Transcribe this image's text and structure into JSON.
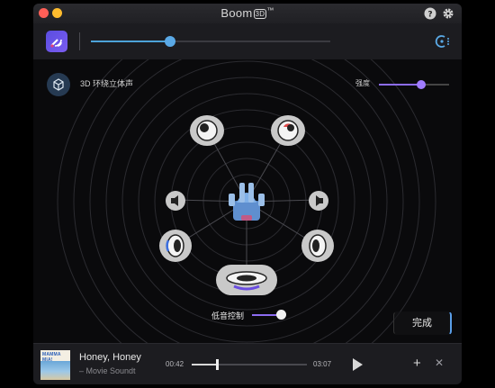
{
  "window": {
    "title": "Boom",
    "title_badge": "3D",
    "title_mark": "™"
  },
  "toolbar": {
    "volume_level": 0.33
  },
  "surround": {
    "label": "3D 环绕立体声",
    "strength_label": "强度",
    "strength_level": 0.6,
    "bass_label": "低音控制",
    "bass_level": 0.9,
    "done_label": "完成"
  },
  "player": {
    "song_title": "Honey, Honey",
    "album_sub": "– Movie Soundtrack",
    "album_art_text": "MAMMA MIA!",
    "time_current": "00:42",
    "time_total": "03:07",
    "progress": 0.22
  },
  "colors": {
    "accent_blue": "#4da3d9",
    "accent_purple": "#8c6cf0"
  },
  "icons": [
    "help-icon",
    "gear-icon",
    "app-logo-icon",
    "output-device-icon",
    "cube-icon",
    "speaker-icon",
    "head-icon",
    "play-icon",
    "add-icon",
    "close-icon"
  ]
}
